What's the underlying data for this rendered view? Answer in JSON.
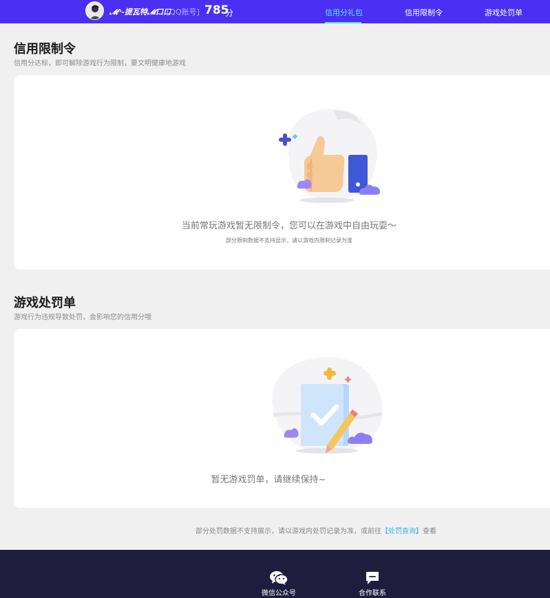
{
  "header": {
    "username": "𝓜ⁿ-提瓦特𝓜口口",
    "account_type": "[QQ账号]",
    "score": "785",
    "score_unit": "分",
    "tabs": [
      {
        "label": "信用分礼包",
        "active": true
      },
      {
        "label": "信用限制令",
        "active": false
      },
      {
        "label": "游戏处罚单",
        "active": false
      }
    ]
  },
  "restriction": {
    "title": "信用限制令",
    "subtitle": "信用分达标，即可解除游戏行为限制，要文明健康地游戏",
    "empty_text": "当前常玩游戏暂无限制令，您可以在游戏中自由玩耍～",
    "note": "部分限制数据不支持显示，请以游戏内限制记录为准"
  },
  "penalty": {
    "title": "游戏处罚单",
    "subtitle": "游戏行为违规导致处罚，会影响您的信用分哦",
    "empty_text": "暂无游戏罚单，请继续保持~"
  },
  "bottom_note": {
    "text_before": "部分处罚数据不支持展示，请以游戏内处罚记录为准，或前往",
    "link": "【处罚查询】",
    "text_after": "查看"
  },
  "footer": {
    "items": [
      {
        "label": "微信公众号",
        "icon": "wechat-icon"
      },
      {
        "label": "合作联系",
        "icon": "chat-icon"
      }
    ]
  },
  "colors": {
    "header_bg": "#4b2ff2",
    "active_tab": "#5ee6f7",
    "footer_bg": "#1e1d3e",
    "link": "#33b5e5"
  }
}
